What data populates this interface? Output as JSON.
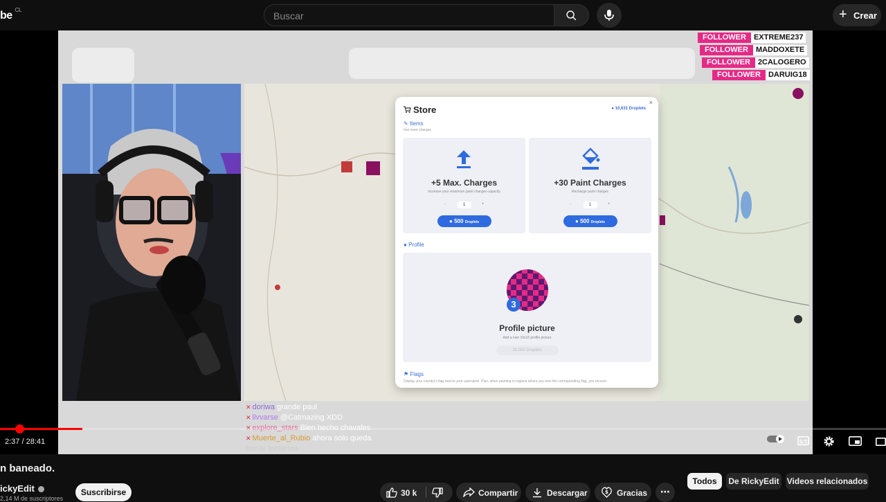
{
  "header": {
    "logo_text": "be",
    "region": "CL",
    "search_placeholder": "Buscar",
    "create_label": "Crear"
  },
  "video": {
    "alerts": [
      {
        "type": "FOLLOWER",
        "name": "EXTREME237"
      },
      {
        "type": "FOLLOWER",
        "name": "MADDOXETE"
      },
      {
        "type": "FOLLOWER",
        "name": "2CALOGERO"
      },
      {
        "type": "FOLLOWER",
        "name": "DARUIG18"
      }
    ],
    "store": {
      "title": "Store",
      "droplets": "10,631 Droplets",
      "items_label": "Items",
      "items_sub": "Get more charges",
      "cards": [
        {
          "title": "+5 Max. Charges",
          "desc": "Increase your maximum paint charges capacity",
          "qty": "1",
          "price": "500",
          "unit": "Droplets"
        },
        {
          "title": "+30 Paint Charges",
          "desc": "Recharge paint charges",
          "qty": "1",
          "price": "500",
          "unit": "Droplets"
        }
      ],
      "profile_label": "Profile",
      "profile_badge": "3",
      "profile_title": "Profile picture",
      "profile_desc": "Add a new 16x16 profile picture",
      "profile_price": "20,000 Droplets",
      "flags_label": "Flags",
      "flags_desc": "Display your country's flag next to your username. Plus, when painting in regions where you own the corresponding flag, you recover"
    },
    "chat": [
      {
        "user": "doriwa",
        "msg": "grande paul"
      },
      {
        "user": "llvvarse",
        "msg": "@Catmazing XDD"
      },
      {
        "user": "explore_stars",
        "msg": "Bien hecho chavales"
      },
      {
        "user": "Muerte_al_Rubio",
        "msg": "ahora solo queda"
      },
      {
        "user": "",
        "msg": "borrar tonterías"
      }
    ],
    "progress_fraction": 0.0927,
    "buffered_fraction": 0.034,
    "current_time": "2:37",
    "duration": "28:41",
    "time_display": "2:37 / 28:41"
  },
  "info": {
    "title": "n baneado.",
    "channel": "ickyEdit",
    "subscribers": "2,14 M de suscriptores",
    "subscribe_label": "Suscribirse",
    "likes": "30 k",
    "share_label": "Compartir",
    "download_label": "Descargar",
    "thanks_label": "Gracias"
  },
  "chips": [
    "Todos",
    "De RickyEdit",
    "Videos relacionados"
  ],
  "colors": {
    "accent_red": "#ff0000",
    "alert_pink": "#e52a86",
    "store_blue": "#2f6be0"
  }
}
